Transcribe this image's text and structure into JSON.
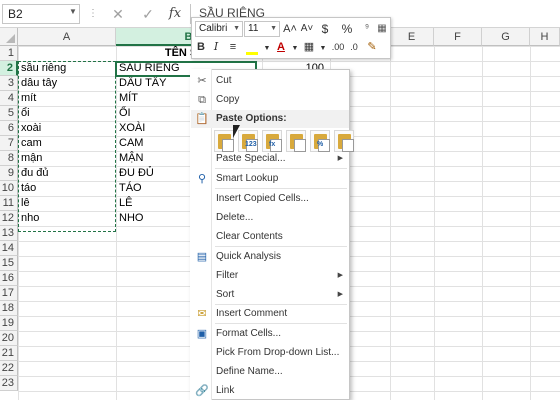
{
  "formula_bar": {
    "name_box": "B2",
    "cancel_icon": "✕",
    "confirm_icon": "✓",
    "fx_label": "fx",
    "content": "SẦU RIÊNG"
  },
  "columns": [
    "A",
    "B",
    "C",
    "D",
    "E",
    "F",
    "G",
    "H"
  ],
  "rows": [
    "1",
    "2",
    "3",
    "4",
    "5",
    "6",
    "7",
    "8",
    "9",
    "10",
    "11",
    "12",
    "13",
    "14",
    "15",
    "16",
    "17",
    "18",
    "19",
    "20",
    "21",
    "22",
    "23"
  ],
  "sheet": {
    "b1_header": "TÊN SẢN",
    "c2_value": "100",
    "col_a": [
      "sầu riêng",
      "dâu tây",
      "mít",
      "ổi",
      "xoài",
      "cam",
      "mận",
      "đu đủ",
      "táo",
      "lê",
      "nho"
    ],
    "col_b": [
      "SẦU RIÊNG",
      "DÂU TÂY",
      "MÍT",
      "ỔI",
      "XOÀI",
      "CAM",
      "MẬN",
      "ĐU ĐỦ",
      "TÁO",
      "LÊ",
      "NHO"
    ]
  },
  "mini_toolbar": {
    "font": "Calibri",
    "size": "11",
    "grow_font": "A˄",
    "shrink_font": "A˅",
    "currency": "$",
    "percent": "%",
    "bold": "B",
    "italic": "I"
  },
  "context_menu": {
    "cut": "Cut",
    "copy": "Copy",
    "paste_options": "Paste Options:",
    "paste_tags": [
      "",
      "123",
      "fx",
      "",
      "%",
      ""
    ],
    "paste_special": "Paste Special...",
    "smart_lookup": "Smart Lookup",
    "insert_copied": "Insert Copied Cells...",
    "delete": "Delete...",
    "clear_contents": "Clear Contents",
    "quick_analysis": "Quick Analysis",
    "filter": "Filter",
    "sort": "Sort",
    "insert_comment": "Insert Comment",
    "format_cells": "Format Cells...",
    "pick_list": "Pick From Drop-down List...",
    "define_name": "Define Name...",
    "link": "Link"
  },
  "colors": {
    "excel_green": "#217346",
    "selection_header": "#d3f0e0",
    "paste_gold": "#d8a93c"
  }
}
